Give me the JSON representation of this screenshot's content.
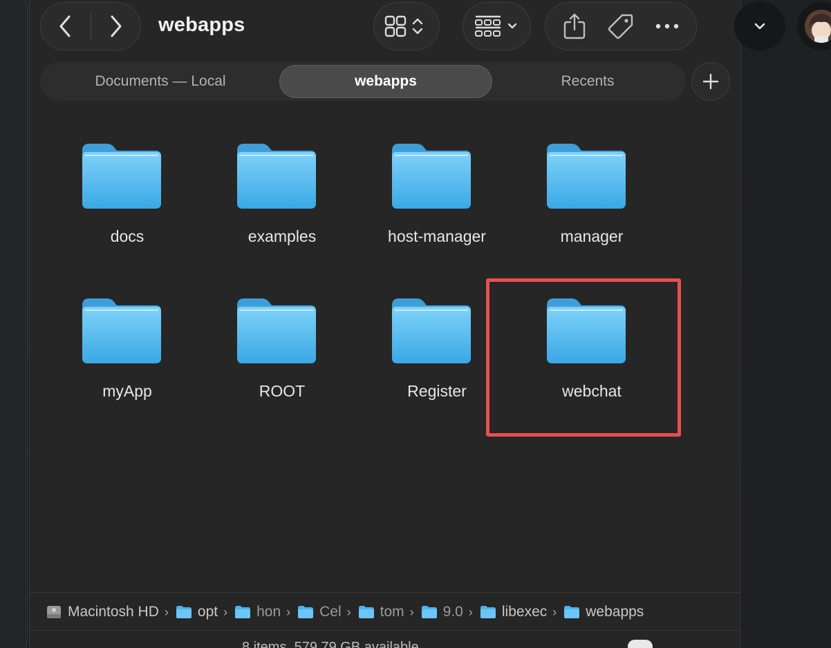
{
  "window": {
    "title": "webapps"
  },
  "toolbar": {
    "back_icon": "chevron-left-icon",
    "forward_icon": "chevron-right-icon",
    "view_icon": "icon-grid-view-icon",
    "group_icon": "group-by-icon",
    "share_icon": "share-icon",
    "tag_icon": "tag-icon",
    "more_icon": "more-icon"
  },
  "tabs": [
    {
      "label": "Documents — Local",
      "active": false
    },
    {
      "label": "webapps",
      "active": true
    },
    {
      "label": "Recents",
      "active": false
    }
  ],
  "items": [
    {
      "name": "docs"
    },
    {
      "name": "examples"
    },
    {
      "name": "host-manager"
    },
    {
      "name": "manager"
    },
    {
      "name": "myApp"
    },
    {
      "name": "ROOT"
    },
    {
      "name": "Register"
    },
    {
      "name": "webchat",
      "highlighted": true
    }
  ],
  "pathbar": [
    {
      "label": "Macintosh HD",
      "icon": "disk-icon"
    },
    {
      "label": "opt",
      "icon": "folder-icon"
    },
    {
      "label": "hon",
      "icon": "folder-icon"
    },
    {
      "label": "Cel",
      "icon": "folder-icon"
    },
    {
      "label": "tom",
      "icon": "folder-icon"
    },
    {
      "label": "9.0",
      "icon": "folder-icon"
    },
    {
      "label": "libexec",
      "icon": "folder-icon"
    },
    {
      "label": "webapps",
      "icon": "folder-icon"
    }
  ],
  "status": {
    "text": "8 items, 579.79 GB available"
  },
  "colors": {
    "highlight": "#e8504f",
    "folder_top": "#7dd0f7",
    "folder_bottom": "#3aa9e6"
  }
}
